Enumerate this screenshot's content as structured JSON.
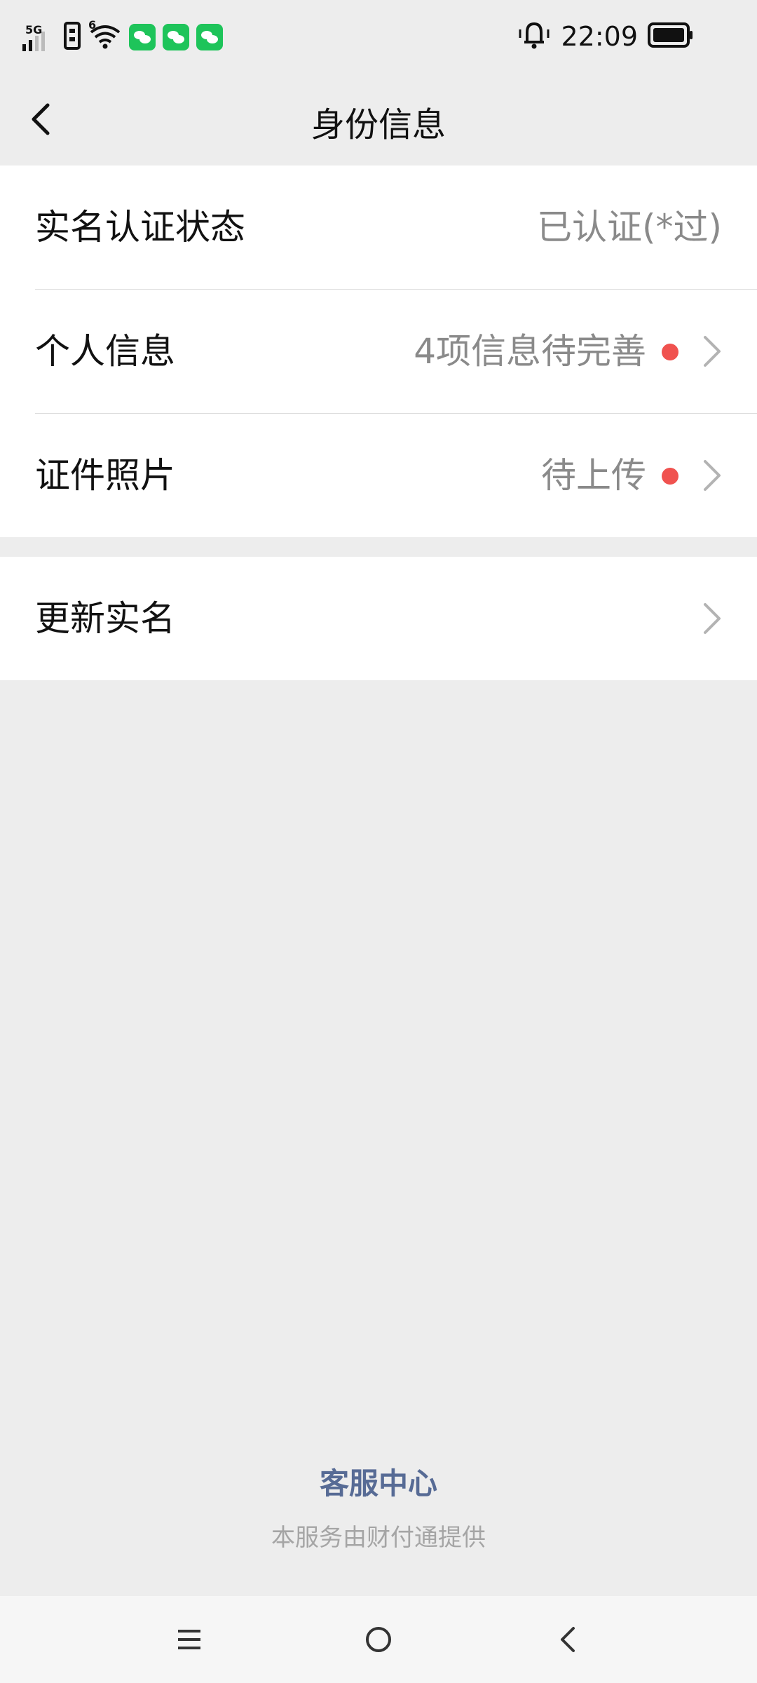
{
  "status_bar": {
    "network_type": "5G",
    "wifi_label": "6",
    "time": "22:09",
    "icons": [
      "signal-icon",
      "sim-icon",
      "wifi-icon",
      "wechat-icon",
      "wechat-icon",
      "wechat-icon",
      "alarm-bell-icon",
      "battery-icon"
    ]
  },
  "header": {
    "title": "身份信息"
  },
  "section1": {
    "rows": [
      {
        "label": "实名认证状态",
        "value": "已认证(*过)"
      },
      {
        "label": "个人信息",
        "value": "4项信息待完善"
      },
      {
        "label": "证件照片",
        "value": "待上传"
      }
    ]
  },
  "section2": {
    "rows": [
      {
        "label": "更新实名"
      }
    ]
  },
  "footer": {
    "customer_service": "客服中心",
    "provider": "本服务由财付通提供"
  },
  "colors": {
    "background": "#ededed",
    "card": "#ffffff",
    "link": "#576b95",
    "dot": "#f0524f",
    "value_text": "#8a8a8a"
  }
}
